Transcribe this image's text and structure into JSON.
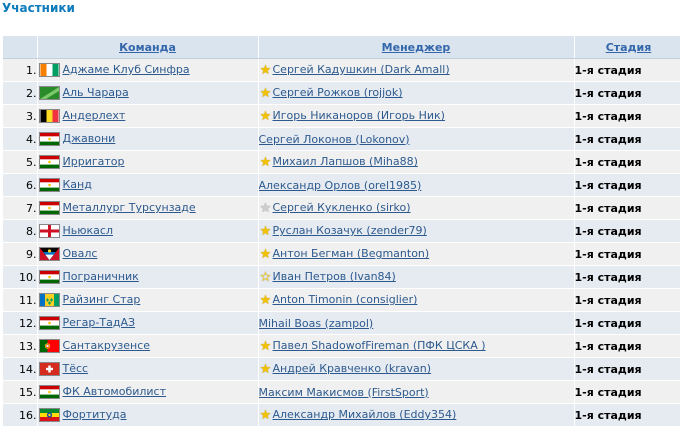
{
  "page_title": "Участники",
  "columns": {
    "team": "Команда",
    "manager": "Менеджер",
    "stage": "Стадия"
  },
  "rows": [
    {
      "num": "1.",
      "team": "Аджаме Клуб Синфра",
      "flag": "civ",
      "star": "gold",
      "manager": "Сергей Кадушкин (Dark Amall)",
      "stage": "1-я стадия"
    },
    {
      "num": "2.",
      "team": "Аль Чарара",
      "flag": "green-diag",
      "star": "gold",
      "manager": "Сергей Рожков (rojjok)",
      "stage": "1-я стадия"
    },
    {
      "num": "3.",
      "team": "Андерлехт",
      "flag": "bel",
      "star": "gold",
      "manager": "Игорь Никаноров (Игорь Ник)",
      "stage": "1-я стадия"
    },
    {
      "num": "4.",
      "team": "Джавони",
      "flag": "tjk",
      "star": "none",
      "manager": "Сергей Локонов (Lokonov)",
      "stage": "1-я стадия"
    },
    {
      "num": "5.",
      "team": "Ирригатор",
      "flag": "tjk",
      "star": "gold",
      "manager": "Михаил Лапшов (Miha88)",
      "stage": "1-я стадия"
    },
    {
      "num": "6.",
      "team": "Канд",
      "flag": "tjk",
      "star": "none",
      "manager": "Александр Орлов (orel1985)",
      "stage": "1-я стадия"
    },
    {
      "num": "7.",
      "team": "Металлург Турсунзаде",
      "flag": "tjk",
      "star": "grey",
      "manager": "Сергей Кукленко (sirko)",
      "stage": "1-я стадия"
    },
    {
      "num": "8.",
      "team": "Ньюкасл",
      "flag": "eng",
      "star": "gold",
      "manager": "Руслан Козачук (zender79)",
      "stage": "1-я стадия"
    },
    {
      "num": "9.",
      "team": "Овалс",
      "flag": "atg",
      "star": "gold",
      "manager": "Антон Бегман (Begmanton)",
      "stage": "1-я стадия"
    },
    {
      "num": "10.",
      "team": "Пограничник",
      "flag": "tjk",
      "star": "hollow",
      "manager": "Иван Петров (Ivan84)",
      "stage": "1-я стадия"
    },
    {
      "num": "11.",
      "team": "Райзинг Стар",
      "flag": "vct",
      "star": "gold",
      "manager": "Anton Timonin (consiglier)",
      "stage": "1-я стадия"
    },
    {
      "num": "12.",
      "team": "Регар-ТадАЗ",
      "flag": "tjk",
      "star": "none",
      "manager": "Mihail Boas (zampol)",
      "stage": "1-я стадия"
    },
    {
      "num": "13.",
      "team": "Сантакрузенсе",
      "flag": "por",
      "star": "gold",
      "manager": "Павел ShadowofFireman (ПФК ЦСКА )",
      "stage": "1-я стадия"
    },
    {
      "num": "14.",
      "team": "Тёсс",
      "flag": "sui",
      "star": "gold",
      "manager": "Андрей Кравченко (kravan)",
      "stage": "1-я стадия"
    },
    {
      "num": "15.",
      "team": "ФК Автомобилист",
      "flag": "tjk",
      "star": "none",
      "manager": "Максим Макисмов (FirstSport)",
      "stage": "1-я стадия"
    },
    {
      "num": "16.",
      "team": "Фортитуда",
      "flag": "eth",
      "star": "gold",
      "manager": "Александр Михайлов (Eddy354)",
      "stage": "1-я стадия"
    }
  ]
}
